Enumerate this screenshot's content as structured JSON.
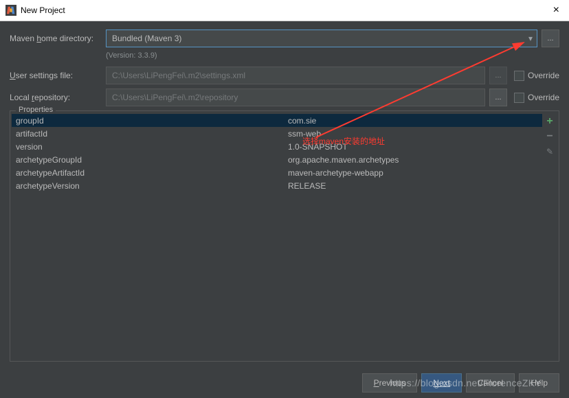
{
  "window": {
    "title": "New Project"
  },
  "labels": {
    "maven_home": "Maven home directory:",
    "user_settings": "User settings file:",
    "local_repo": "Local repository:",
    "override": "Override",
    "properties": "Properties"
  },
  "maven": {
    "home_value": "Bundled (Maven 3)",
    "version_note": "(Version: 3.3.9)"
  },
  "settings": {
    "user_file": "C:\\Users\\LiPengFei\\.m2\\settings.xml",
    "local_repo": "C:\\Users\\LiPengFei\\.m2\\repository"
  },
  "properties_rows": [
    {
      "key": "groupId",
      "value": "com.sie"
    },
    {
      "key": "artifactId",
      "value": "ssm-web"
    },
    {
      "key": "version",
      "value": "1.0-SNAPSHOT"
    },
    {
      "key": "archetypeGroupId",
      "value": "org.apache.maven.archetypes"
    },
    {
      "key": "archetypeArtifactId",
      "value": "maven-archetype-webapp"
    },
    {
      "key": "archetypeVersion",
      "value": "RELEASE"
    }
  ],
  "buttons": {
    "previous": "Previous",
    "next": "Next",
    "cancel": "Cancel",
    "help": "Help",
    "ellipsis": "..."
  },
  "annotation": "选择maven安装的地址",
  "watermark": "https://blog.csdn.net/FlorenceZKY"
}
